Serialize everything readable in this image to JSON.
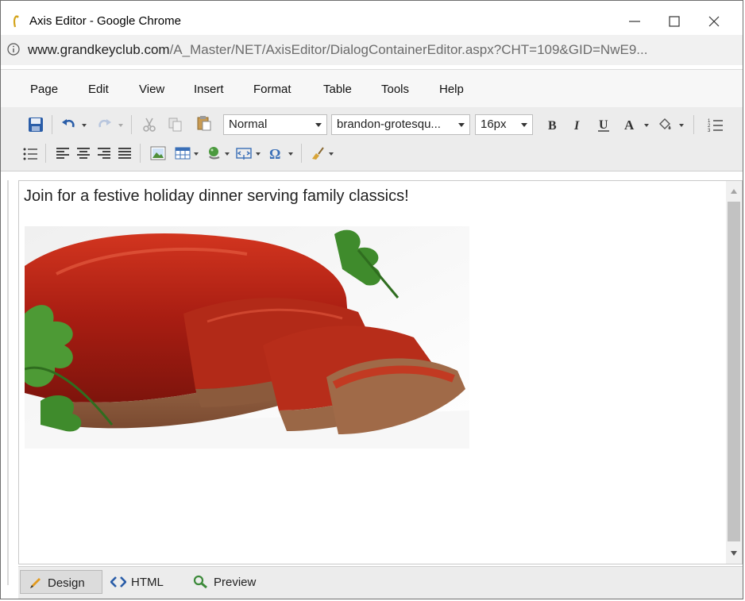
{
  "window": {
    "title": "Axis Editor - Google Chrome",
    "controls": {
      "minimize": "—",
      "maximize": "☐",
      "close": "✕"
    }
  },
  "address": {
    "domain": "www.grandkeyclub.com",
    "path": "/A_Master/NET/AxisEditor/DialogContainerEditor.aspx?CHT=109&GID=NwE9..."
  },
  "menu": {
    "items": [
      "Page",
      "Edit",
      "View",
      "Insert",
      "Format",
      "Table",
      "Tools",
      "Help"
    ]
  },
  "toolbar": {
    "paragraph_format": "Normal",
    "font_name": "brandon-grotesqu...",
    "font_size": "16px",
    "icons": [
      "save-icon",
      "undo-icon",
      "redo-icon",
      "cut-icon",
      "copy-icon",
      "paste-icon",
      "bold-icon",
      "italic-icon",
      "underline-icon",
      "font-color-icon",
      "highlight-color-icon",
      "ordered-list-icon",
      "unordered-list-icon",
      "align-left-icon",
      "align-center-icon",
      "align-right-icon",
      "justify-icon",
      "insert-image-icon",
      "insert-table-icon",
      "insert-link-icon",
      "insert-media-icon",
      "special-character-icon",
      "format-stripper-icon"
    ]
  },
  "editor": {
    "lead_text": "Join for a festive holiday dinner serving family classics!",
    "image": "meatloaf-photo"
  },
  "modes": {
    "design": "Design",
    "html": "HTML",
    "preview": "Preview",
    "active": "Design"
  },
  "colors": {
    "toolbar_bg": "#ececec",
    "address_bg": "#f1f1f1",
    "scrollbar_thumb": "#c2c2c2",
    "save_icon": "#2a5da8"
  }
}
